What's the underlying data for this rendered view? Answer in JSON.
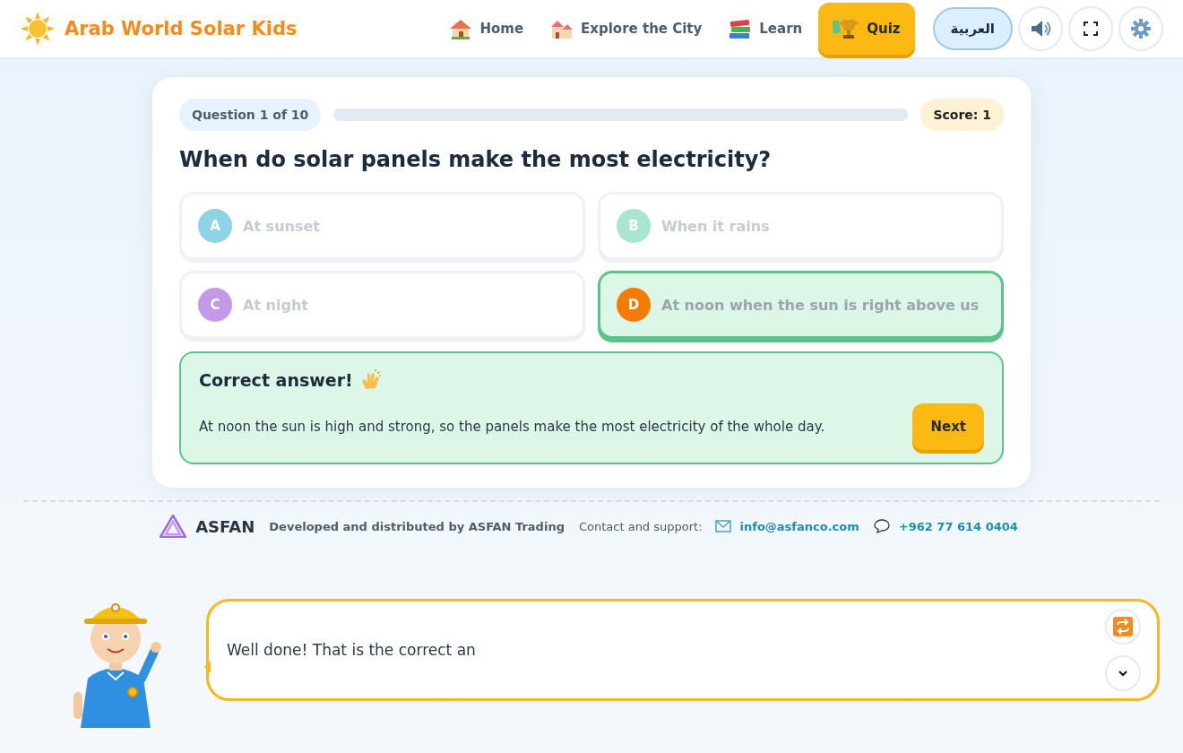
{
  "header": {
    "brand": "Arab World Solar Kids",
    "nav": [
      {
        "label": "Home",
        "kind": "home",
        "selected": false
      },
      {
        "label": "Explore the City",
        "kind": "city",
        "selected": false
      },
      {
        "label": "Learn",
        "kind": "books",
        "selected": false
      },
      {
        "label": "Quiz",
        "kind": "trophy",
        "selected": true
      }
    ],
    "language_button": "العربية"
  },
  "quiz": {
    "counter": "Question 1 of 10",
    "progress": {
      "level": 0
    },
    "score": "Score: 1",
    "question": "When do solar panels make the most electricity?",
    "options": [
      {
        "letter": "A",
        "text": "At sunset",
        "color": "#8fd3e6",
        "selected": false
      },
      {
        "letter": "B",
        "text": "When it rains",
        "color": "#a8e6cf",
        "selected": false
      },
      {
        "letter": "C",
        "text": "At night",
        "color": "#c49ae6",
        "selected": false
      },
      {
        "letter": "D",
        "text": "At noon when the sun is right above us",
        "color": "#f57c00",
        "selected": true
      }
    ],
    "feedback": {
      "title": "Correct answer!",
      "text": "At noon the sun is high and strong, so the panels make the most electricity of the whole day.",
      "button": "Next"
    }
  },
  "footer": {
    "brand": "ASFAN",
    "credit": "Developed and distributed by ASFAN Trading",
    "contact_label": "Contact and support:",
    "email": "info@asfanco.com",
    "phone": "+962 77 614 0404"
  },
  "assistant": {
    "message": "Well done! That is the correct an"
  }
}
